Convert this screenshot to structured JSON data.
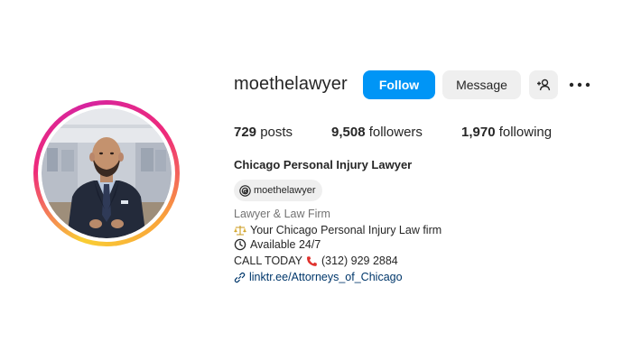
{
  "profile": {
    "username": "moethelawyer",
    "follow_label": "Follow",
    "message_label": "Message",
    "stats": {
      "posts_count": "729",
      "posts_label": "posts",
      "followers_count": "9,508",
      "followers_label": "followers",
      "following_count": "1,970",
      "following_label": "following"
    },
    "full_name": "Chicago Personal Injury Lawyer",
    "threads_handle": "moethelawyer",
    "category": "Lawyer & Law Firm",
    "bio": {
      "line1": "Your Chicago Personal Injury Law firm",
      "line2": "Available 24/7",
      "line3_prefix": "CALL TODAY",
      "line3_phone": "(312) 929 2884"
    },
    "link": "linktr.ee/Attorneys_of_Chicago"
  },
  "colors": {
    "follow_button": "#0095f6",
    "secondary_button": "#efefef",
    "link": "#00376b",
    "category": "#737373"
  },
  "icons": {
    "suggest": "add-person-icon",
    "more": "more-options-icon",
    "threads": "threads-icon",
    "scales": "scales-icon",
    "clock": "clock-icon",
    "phone": "phone-icon",
    "link": "link-icon"
  }
}
